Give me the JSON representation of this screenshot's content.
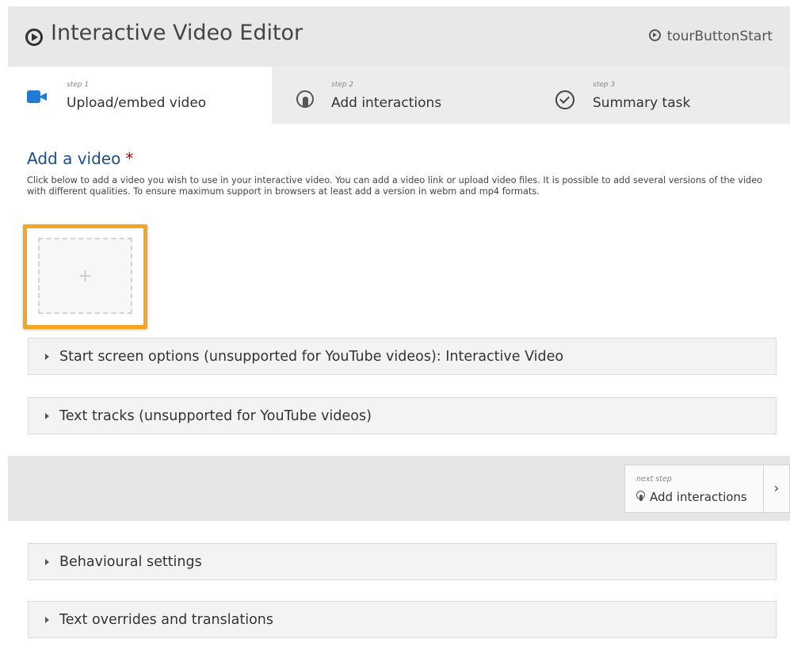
{
  "header": {
    "title": "Interactive Video Editor",
    "tour_label": "tourButtonStart"
  },
  "tabs": [
    {
      "step": "step 1",
      "label": "Upload/embed video",
      "icon": "video-camera-icon",
      "active": true
    },
    {
      "step": "step 2",
      "label": "Add interactions",
      "icon": "hand-pointer-icon",
      "active": false
    },
    {
      "step": "step 3",
      "label": "Summary task",
      "icon": "check-circle-icon",
      "active": false
    }
  ],
  "video_section": {
    "title": "Add a video",
    "required_mark": "*",
    "description": "Click below to add a video you wish to use in your interactive video. You can add a video link or upload video files. It is possible to add several versions of the video with different qualities. To ensure maximum support in browsers at least add a version in webm and mp4 formats.",
    "add_symbol": "+"
  },
  "accordions": [
    {
      "label": "Start screen options (unsupported for YouTube videos): Interactive Video"
    },
    {
      "label": "Text tracks (unsupported for YouTube videos)"
    },
    {
      "label": "Behavioural settings"
    },
    {
      "label": "Text overrides and translations"
    }
  ],
  "next_step": {
    "caption": "next step",
    "label": "Add interactions",
    "arrow": "›"
  },
  "colors": {
    "accent_blue": "#1f7bd6",
    "title_blue": "#1e4f8a",
    "highlight_orange": "#f4a623",
    "required_red": "#c00000"
  }
}
